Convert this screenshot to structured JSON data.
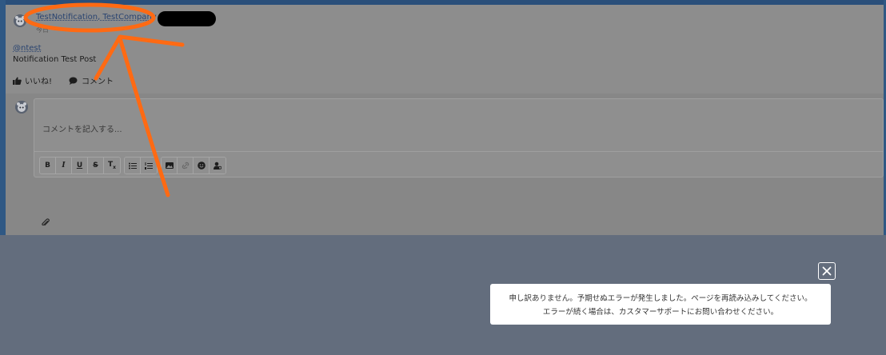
{
  "post": {
    "author": "TestNotification, TestCompany",
    "sub_meta": "今日",
    "mention": "@ntest",
    "body": "Notification Test Post",
    "like_label": "いいね!",
    "comment_label": "コメント"
  },
  "comment": {
    "placeholder": "コメントを記入する...",
    "toolbar": [
      [
        "bold-icon",
        "italic-icon",
        "underline-icon",
        "strikethrough-icon",
        "clear-format-icon"
      ],
      [
        "bullet-list-icon",
        "numbered-list-icon"
      ],
      [
        "image-icon",
        "link-icon",
        "emoji-icon",
        "mention-icon"
      ]
    ]
  },
  "toast": {
    "line1": "申し訳ありません。予期せぬエラーが発生しました。ページを再読み込みしてください。",
    "line2": "エラーが続く場合は、カスタマーサポートにお問い合わせください。"
  },
  "colors": {
    "accent_link": "#2a4470",
    "annotation": "#ff6a13",
    "overlay": "#636d7d",
    "toast_bg": "#ffffff"
  }
}
